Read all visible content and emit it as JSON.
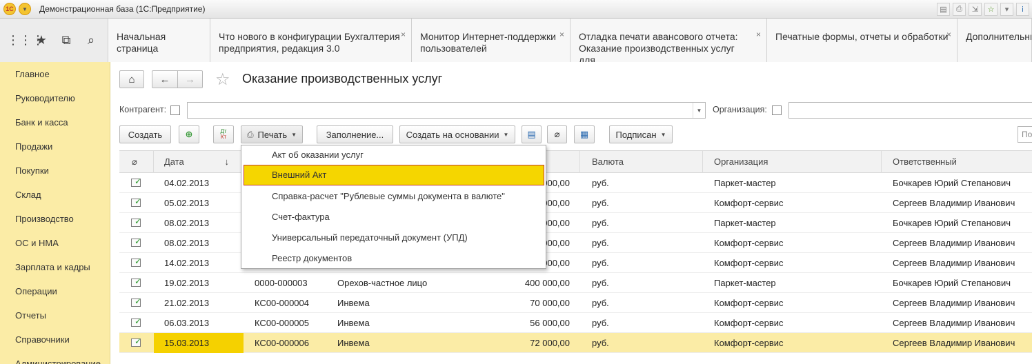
{
  "window": {
    "title": "Демонстрационная база  (1С:Предприятие)"
  },
  "tabs": [
    {
      "label": "Начальная страница",
      "closable": false
    },
    {
      "label": "Что нового в конфигурации Бухгалтерия предприятия, редакция 3.0",
      "closable": true
    },
    {
      "label": "Монитор Интернет-поддержки пользователей",
      "closable": true
    },
    {
      "label": "Отладка печати авансового отчета: Оказание производственных услуг для...",
      "closable": true
    },
    {
      "label": "Печатные формы, отчеты и обработки",
      "closable": true
    },
    {
      "label": "Дополнительны",
      "closable": false
    }
  ],
  "sidebar": {
    "items": [
      {
        "label": "Главное"
      },
      {
        "label": "Руководителю"
      },
      {
        "label": "Банк и касса"
      },
      {
        "label": "Продажи"
      },
      {
        "label": "Покупки"
      },
      {
        "label": "Склад"
      },
      {
        "label": "Производство"
      },
      {
        "label": "ОС и НМА"
      },
      {
        "label": "Зарплата и кадры"
      },
      {
        "label": "Операции"
      },
      {
        "label": "Отчеты"
      },
      {
        "label": "Справочники"
      },
      {
        "label": "Администрирование"
      }
    ]
  },
  "page": {
    "title": "Оказание производственных услуг"
  },
  "filters": {
    "counterparty_label": "Контрагент:",
    "counterparty_value": "",
    "organization_label": "Организация:",
    "organization_value": ""
  },
  "toolbar": {
    "create": "Создать",
    "print": "Печать",
    "fill": "Заполнение...",
    "create_based": "Создать на основании",
    "signed": "Подписан",
    "search_placeholder": "По"
  },
  "print_menu": {
    "items": [
      {
        "label": "Акт об оказании услуг",
        "highlighted": false
      },
      {
        "label": "Внешний Акт",
        "highlighted": true
      },
      {
        "label": "Справка-расчет \"Рублевые суммы документа в валюте\"",
        "highlighted": false
      },
      {
        "label": "Счет-фактура",
        "highlighted": false
      },
      {
        "label": "Универсальный передаточный документ (УПД)",
        "highlighted": false
      },
      {
        "label": "Реестр документов",
        "highlighted": false
      }
    ]
  },
  "table": {
    "columns": {
      "attach": "",
      "date": "Дата",
      "sort_indicator": "↓",
      "currency": "Валюта",
      "organization": "Организация",
      "responsible": "Ответственный"
    },
    "rows": [
      {
        "date": "04.02.2013",
        "number": "",
        "counterparty": "",
        "amount": "000,00",
        "currency": "руб.",
        "organization": "Паркет-мастер",
        "responsible": "Бочкарев Юрий Степанович",
        "selected": false
      },
      {
        "date": "05.02.2013",
        "number": "",
        "counterparty": "",
        "amount": "000,00",
        "currency": "руб.",
        "organization": "Комфорт-сервис",
        "responsible": "Сергеев Владимир Иванович",
        "selected": false
      },
      {
        "date": "08.02.2013",
        "number": "",
        "counterparty": "",
        "amount": "000,00",
        "currency": "руб.",
        "organization": "Паркет-мастер",
        "responsible": "Бочкарев Юрий Степанович",
        "selected": false
      },
      {
        "date": "08.02.2013",
        "number": "",
        "counterparty": "",
        "amount": "000,00",
        "currency": "руб.",
        "organization": "Комфорт-сервис",
        "responsible": "Сергеев Владимир Иванович",
        "selected": false
      },
      {
        "date": "14.02.2013",
        "number": "",
        "counterparty": "",
        "amount": "000,00",
        "currency": "руб.",
        "organization": "Комфорт-сервис",
        "responsible": "Сергеев Владимир Иванович",
        "selected": false
      },
      {
        "date": "19.02.2013",
        "number": "0000-000003",
        "counterparty": "Орехов-частное лицо",
        "amount": "400 000,00",
        "currency": "руб.",
        "organization": "Паркет-мастер",
        "responsible": "Бочкарев Юрий Степанович",
        "selected": false
      },
      {
        "date": "21.02.2013",
        "number": "КС00-000004",
        "counterparty": "Инвема",
        "amount": "70 000,00",
        "currency": "руб.",
        "organization": "Комфорт-сервис",
        "responsible": "Сергеев Владимир Иванович",
        "selected": false
      },
      {
        "date": "06.03.2013",
        "number": "КС00-000005",
        "counterparty": "Инвема",
        "amount": "56 000,00",
        "currency": "руб.",
        "organization": "Комфорт-сервис",
        "responsible": "Сергеев Владимир Иванович",
        "selected": false
      },
      {
        "date": "15.03.2013",
        "number": "КС00-000006",
        "counterparty": "Инвема",
        "amount": "72 000,00",
        "currency": "руб.",
        "organization": "Комфорт-сервис",
        "responsible": "Сергеев Владимир Иванович",
        "selected": true
      }
    ]
  }
}
